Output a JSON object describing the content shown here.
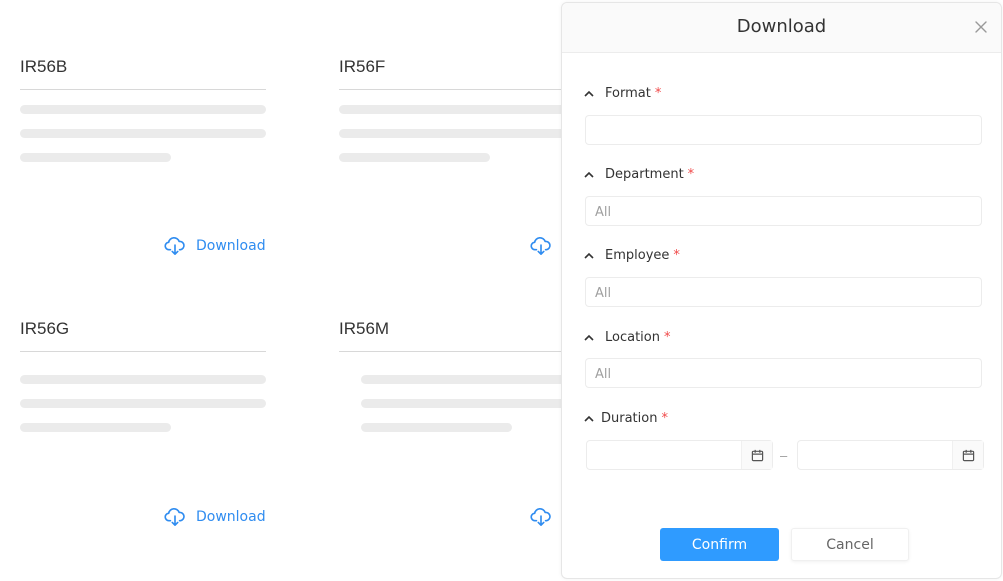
{
  "cards": [
    {
      "title": "IR56B",
      "download_label": "Download"
    },
    {
      "title": "IR56F",
      "download_label": "Download"
    },
    {
      "title": "IR56G",
      "download_label": "Download"
    },
    {
      "title": "IR56M",
      "download_label": "Download"
    }
  ],
  "modal": {
    "title": "Download",
    "required_mark": "*",
    "fields": {
      "format": {
        "label": "Format",
        "value": "",
        "placeholder": ""
      },
      "department": {
        "label": "Department",
        "value": "All"
      },
      "employee": {
        "label": "Employee",
        "value": "All"
      },
      "location": {
        "label": "Location",
        "value": "All"
      },
      "duration": {
        "label": "Duration",
        "start": "",
        "end": "",
        "separator": "–"
      }
    },
    "confirm_label": "Confirm",
    "cancel_label": "Cancel"
  },
  "colors": {
    "accent": "#2f9bff",
    "link": "#2f8cf0",
    "required": "#f04848"
  }
}
